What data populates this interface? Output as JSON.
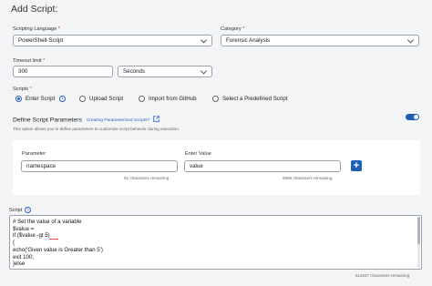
{
  "page_title": "Add Script:",
  "language": {
    "label": "Scripting Language",
    "required_mark": "*",
    "value": "PowerShell-Script"
  },
  "category": {
    "label": "Category",
    "required_mark": "*",
    "value": "Forensic Analysis"
  },
  "timeout": {
    "label": "Timeout limit",
    "required_mark": "*",
    "value": "300",
    "unit": "Seconds"
  },
  "scripts": {
    "label": "Scripts",
    "required_mark": "*",
    "options": [
      {
        "label": "Enter Script",
        "selected": true
      },
      {
        "label": "Upload Script",
        "selected": false
      },
      {
        "label": "Import from GitHub",
        "selected": false
      },
      {
        "label": "Select a Predefined Script",
        "selected": false
      }
    ]
  },
  "params": {
    "title": "Define Script Parameters",
    "link": "Creating Parameterized Scripts?",
    "description": "This option allows you to define parameters to customize script behavior during execution.",
    "toggle_on": true,
    "parameter_label": "Parameter",
    "parameter_value": "namespace",
    "parameter_remaining": "91 characters remaining",
    "enter_value_label": "Enter Value",
    "enter_value_value": "value",
    "enter_value_remaining": "3995 characters remaining",
    "add_symbol": "+"
  },
  "script": {
    "label": "Script",
    "lines": [
      "# Set the value of a variable",
      "$value =",
      "if ($value -gt 5)",
      "{",
      "echo('Given value is Greater than 5')",
      "exit 100;",
      "}else"
    ],
    "remaining": "511837 characters remaining"
  },
  "colors": {
    "accent": "#1f5fb5",
    "required": "#d33333",
    "background": "#f3f4f6"
  }
}
